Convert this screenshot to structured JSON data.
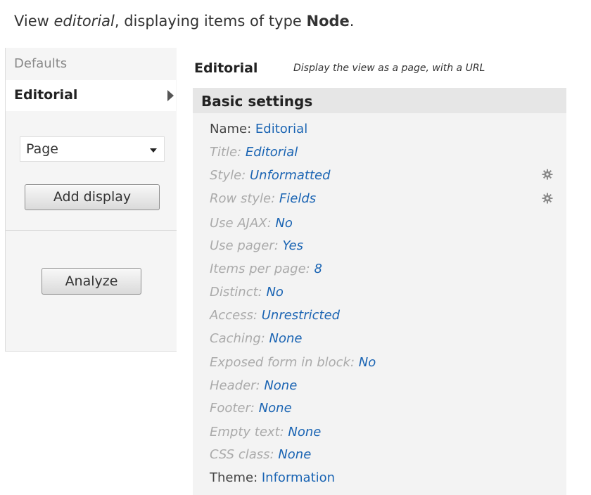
{
  "header": {
    "prefix": "View ",
    "view_name": "editorial",
    "middle": ", displaying items of type ",
    "type": "Node",
    "suffix": "."
  },
  "tabs": {
    "defaults": "Defaults",
    "editorial": "Editorial"
  },
  "add_display": {
    "select_value": "Page",
    "button_label": "Add display"
  },
  "analyze_label": "Analyze",
  "display": {
    "title": "Editorial",
    "description": "Display the view as a page, with a URL"
  },
  "basic_settings": {
    "heading": "Basic settings",
    "rows": [
      {
        "key": "Name: ",
        "value": "Editorial"
      },
      {
        "key": "Title: ",
        "value": "Editorial"
      },
      {
        "key": "Style: ",
        "value": "Unformatted"
      },
      {
        "key": "Row style: ",
        "value": "Fields"
      },
      {
        "key": "Use AJAX: ",
        "value": "No"
      },
      {
        "key": "Use pager: ",
        "value": "Yes"
      },
      {
        "key": "Items per page: ",
        "value": "8"
      },
      {
        "key": "Distinct: ",
        "value": "No"
      },
      {
        "key": "Access: ",
        "value": "Unrestricted"
      },
      {
        "key": "Caching: ",
        "value": "None"
      },
      {
        "key": "Exposed form in block: ",
        "value": "No"
      },
      {
        "key": "Header: ",
        "value": "None"
      },
      {
        "key": "Footer: ",
        "value": "None"
      },
      {
        "key": "Empty text: ",
        "value": "None"
      },
      {
        "key": "CSS class: ",
        "value": "None"
      },
      {
        "key": "Theme: ",
        "value": "Information"
      }
    ]
  },
  "icons": {
    "gear": "gear-icon"
  }
}
